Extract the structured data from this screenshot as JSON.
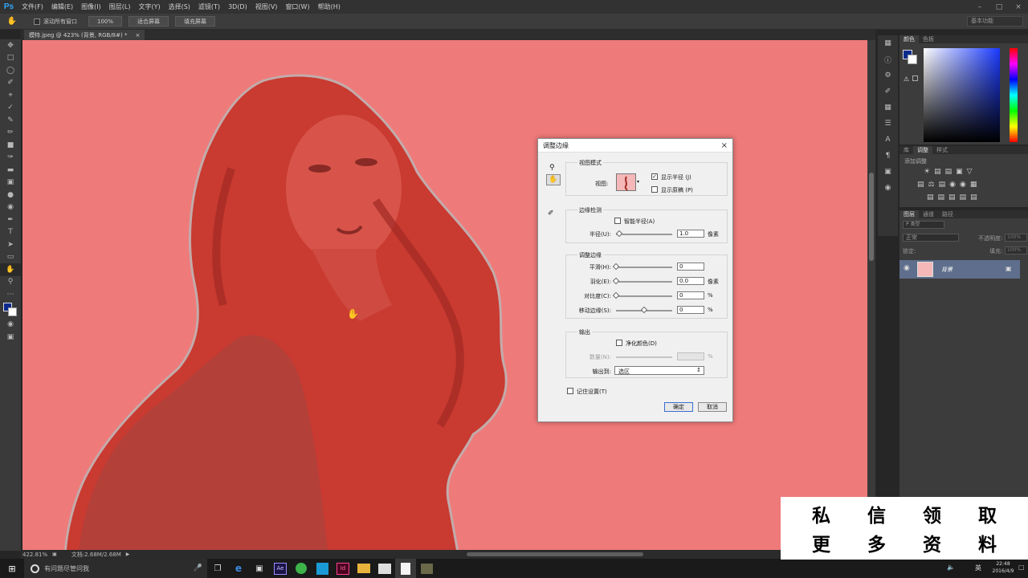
{
  "app": {
    "logo": "Ps"
  },
  "menubar": {
    "items": [
      "文件(F)",
      "编辑(E)",
      "图像(I)",
      "图层(L)",
      "文字(Y)",
      "选择(S)",
      "滤镜(T)",
      "3D(D)",
      "视图(V)",
      "窗口(W)",
      "帮助(H)"
    ]
  },
  "options": {
    "scroll_all": "滚动所有窗口",
    "zoom": "100%",
    "fit_screen": "适合屏幕",
    "fill_screen": "填充屏幕",
    "workspace": "基本功能"
  },
  "document": {
    "tab_title": "模特.jpeg @ 423% (背景, RGB/8#) *",
    "close": "×"
  },
  "status": {
    "zoom": "422.81%",
    "doc_size": "文档:2.68M/2.68M"
  },
  "panels": {
    "color_tabs": [
      "颜色",
      "色板"
    ],
    "adjust_tabs": [
      "库",
      "调整",
      "样式"
    ],
    "adjust_title": "添加调整",
    "layer_tabs": [
      "图层",
      "通道",
      "路径"
    ],
    "kind": "P 类型",
    "blend_mode": "正常",
    "opacity_label": "不透明度:",
    "opacity_value": "100%",
    "lock_label": "锁定:",
    "fill_label": "填充:",
    "fill_value": "100%",
    "layer_name": "背景"
  },
  "dialog": {
    "title": "调整边缘",
    "view_mode": {
      "title": "视图模式",
      "view_label": "视图:",
      "show_radius": "显示半径 (J)",
      "show_original": "显示原稿 (P)",
      "show_radius_checked": true,
      "show_original_checked": false
    },
    "edge_detect": {
      "title": "边缘检测",
      "smart_radius": "智能半径(A)",
      "radius_label": "半径(U):",
      "radius_value": "1.0",
      "radius_unit": "像素"
    },
    "adjust_edge": {
      "title": "调整边缘",
      "smooth_label": "平滑(H):",
      "smooth_value": "0",
      "feather_label": "羽化(E):",
      "feather_value": "0.0",
      "feather_unit": "像素",
      "contrast_label": "对比度(C):",
      "contrast_value": "0",
      "contrast_unit": "%",
      "shift_label": "移动边缘(S):",
      "shift_value": "0",
      "shift_unit": "%"
    },
    "output": {
      "title": "输出",
      "decontaminate": "净化颜色(D)",
      "amount_label": "数量(N):",
      "amount_unit": "%",
      "output_to_label": "输出到:",
      "output_to_value": "选区"
    },
    "remember": "记住设置(T)",
    "ok": "确定",
    "cancel": "取消"
  },
  "taskbar": {
    "search_placeholder": "有问题尽管问我",
    "time": "22:48",
    "date": "2016/4/9",
    "ime": "英"
  },
  "overlay": {
    "row1": [
      "私",
      "信",
      "领",
      "取"
    ],
    "row2": [
      "更",
      "多",
      "资",
      "料"
    ]
  },
  "colors": {
    "canvas_bg": "#ef7a7a",
    "accent": "#31a8ff"
  }
}
